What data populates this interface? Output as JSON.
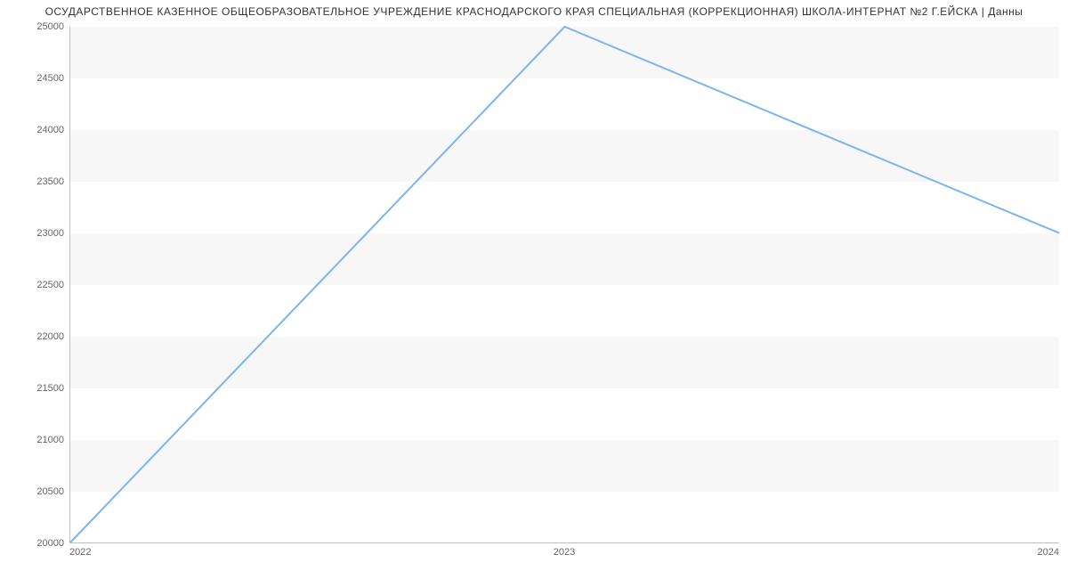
{
  "chart_data": {
    "type": "line",
    "title": "ОСУДАРСТВЕННОЕ КАЗЕННОЕ ОБЩЕОБРАЗОВАТЕЛЬНОЕ УЧРЕЖДЕНИЕ КРАСНОДАРСКОГО КРАЯ СПЕЦИАЛЬНАЯ (КОРРЕКЦИОННАЯ) ШКОЛА-ИНТЕРНАТ №2 Г.ЕЙСКА | Данны",
    "x": [
      "2022",
      "2023",
      "2024"
    ],
    "values": [
      20000,
      25000,
      23000
    ],
    "xlabel": "",
    "ylabel": "",
    "ylim": [
      20000,
      25000
    ],
    "y_ticks": [
      20000,
      20500,
      21000,
      21500,
      22000,
      22500,
      23000,
      23500,
      24000,
      24500,
      25000
    ],
    "line_color": "#7cb5ec"
  }
}
